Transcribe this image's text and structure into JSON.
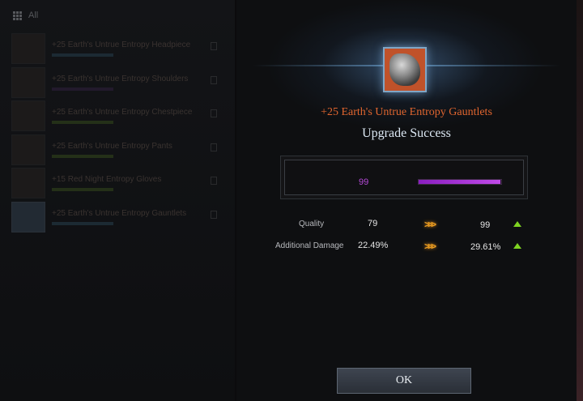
{
  "inventory": {
    "header_label": "All",
    "items": [
      {
        "name": "+25 Earth's Untrue Entropy Headpiece"
      },
      {
        "name": "+25 Earth's Untrue Entropy Shoulders"
      },
      {
        "name": "+25 Earth's Untrue Entropy Chestpiece"
      },
      {
        "name": "+25 Earth's Untrue Entropy Pants"
      },
      {
        "name": "+15 Red Night Entropy Gloves"
      },
      {
        "name": "+25 Earth's Untrue Entropy Gauntlets"
      }
    ]
  },
  "modal": {
    "item_name": "+25 Earth's Untrue Entropy Gauntlets",
    "title": "Upgrade Success",
    "quality_value": "99",
    "quality_fraction": 0.99,
    "stats": [
      {
        "label": "Quality",
        "before": "79",
        "after": "99"
      },
      {
        "label": "Additional Damage",
        "before": "22.49%",
        "after": "29.61%"
      }
    ],
    "ok_label": "OK"
  },
  "icons": {
    "arrow": "triple-chevron-right-icon",
    "increase": "up-triangle-icon",
    "grid": "grid-icon"
  },
  "colors": {
    "item_name": "#e0652e",
    "quality_bar": "#b54ad8",
    "increase": "#7ed321",
    "chevron": "#f0a020"
  }
}
